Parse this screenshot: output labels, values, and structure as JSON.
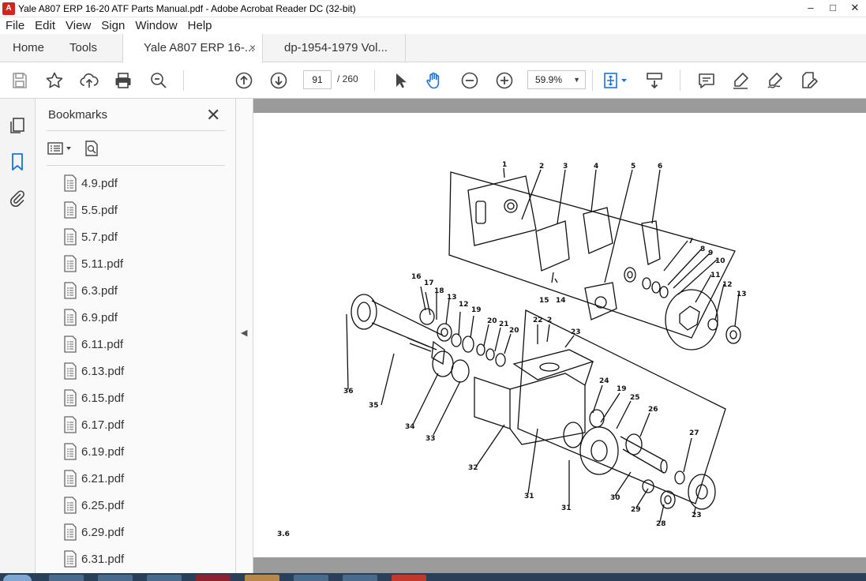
{
  "window": {
    "title": "Yale A807 ERP 16-20 ATF Parts Manual.pdf - Adobe Acrobat Reader DC (32-bit)",
    "app_icon": "acrobat-icon"
  },
  "menu": [
    "File",
    "Edit",
    "View",
    "Sign",
    "Window",
    "Help"
  ],
  "tabs": {
    "home": "Home",
    "tools": "Tools",
    "documents": [
      {
        "label": "Yale A807 ERP 16-...",
        "active": true,
        "close": "×"
      },
      {
        "label": "dp-1954-1979 Vol...",
        "active": false
      }
    ]
  },
  "toolbar": {
    "page_current": "91",
    "page_total": "/ 260",
    "zoom": "59.9%",
    "icons": [
      "save-icon",
      "star-icon",
      "upload-icon",
      "print-icon",
      "zoom-search-icon",
      "page-up-icon",
      "page-down-icon",
      "select-cursor-icon",
      "hand-icon",
      "zoom-out-icon",
      "zoom-in-icon",
      "fit-page-icon",
      "scroll-mode-icon",
      "comment-icon",
      "highlight-icon",
      "sign-icon",
      "fill-sign-icon"
    ]
  },
  "bookmarks": {
    "title": "Bookmarks",
    "close": "✕",
    "items": [
      "4.9.pdf",
      "5.5.pdf",
      "5.7.pdf",
      "5.11.pdf",
      "6.3.pdf",
      "6.9.pdf",
      "6.11.pdf",
      "6.13.pdf",
      "6.15.pdf",
      "6.17.pdf",
      "6.19.pdf",
      "6.21.pdf",
      "6.25.pdf",
      "6.29.pdf",
      "6.31.pdf"
    ]
  },
  "page": {
    "footer": "3.6",
    "part_labels": [
      "1",
      "2",
      "3",
      "4",
      "5",
      "6",
      "7",
      "8",
      "9",
      "10",
      "11",
      "12",
      "13",
      "14",
      "15",
      "16",
      "17",
      "18",
      "13",
      "12",
      "19",
      "20",
      "21",
      "20",
      "22",
      "2",
      "23",
      "24",
      "19",
      "25",
      "26",
      "27",
      "36",
      "35",
      "34",
      "33",
      "32",
      "31",
      "31",
      "30",
      "29",
      "28",
      "23"
    ]
  }
}
